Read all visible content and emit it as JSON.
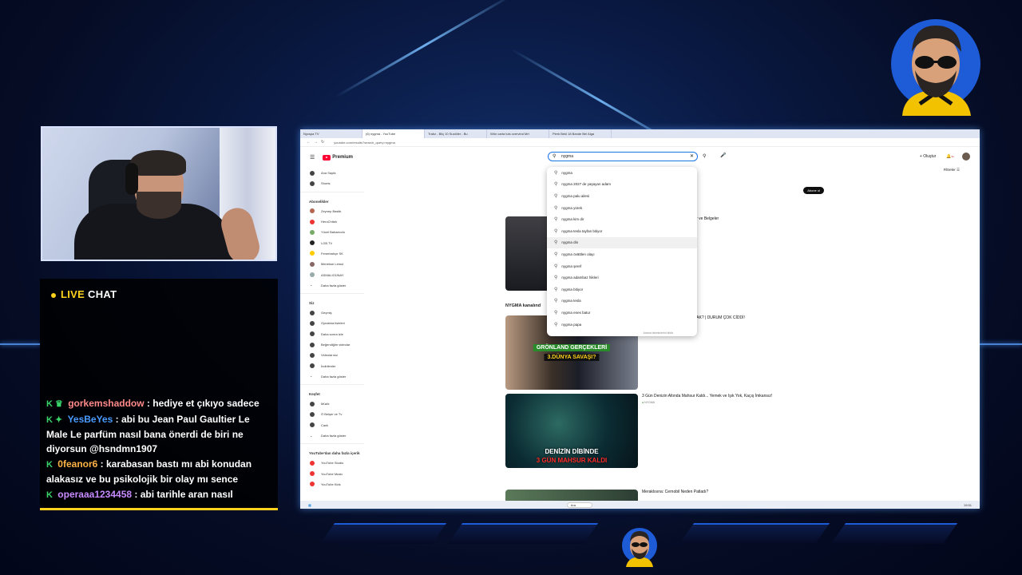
{
  "colors": {
    "accent": "#ffd21e",
    "glow": "#3a86ff",
    "yt_red": "#ff0033",
    "chat_badge": "#39d46a"
  },
  "chat": {
    "title_live": "LIVE",
    "title_chat": "CHAT",
    "messages": [
      {
        "user": "gorkemshaddow",
        "user_color": "#ff8a8a",
        "badge": "K ♛",
        "text": ": hediye et çıkıyo sadece"
      },
      {
        "user": "YesBeYes",
        "user_color": "#4a9bff",
        "badge": "K ✦",
        "text": ": abi bu Jean Paul Gaultier Le Male Le parfüm nasıl bana önerdi de biri ne diyorsun @hsndmn1907"
      },
      {
        "user": "0feanor6",
        "user_color": "#ffb347",
        "badge": "K",
        "text": ": karabasan bastı mı abi konudan alakasız ve bu psikolojik bir olay mı sence"
      },
      {
        "user": "operaaa1234458",
        "user_color": "#c58bff",
        "badge": "K",
        "text": ": abi tarihle aran nasıl"
      }
    ]
  },
  "browser": {
    "tabs": [
      "Nycspa TV",
      "(6) nygma - YouTube",
      "Trabz - Bilç 10 Suclöler - Bu",
      "Wön carta tuis overvind Mrt",
      "Pierk Bekl 18 Bande Bel Alga"
    ],
    "url": "youtube.com/results?search_query=nygma",
    "search_query": "nygma",
    "premium_label": "Premium",
    "create_label": "Oluştur",
    "notif_count": "9+",
    "filters_label": "Filtreler",
    "subscribe_label": "Abone ol",
    "suggestions": [
      "nygma",
      "nygma 2027 de yaşayan adam",
      "nygma palu ailesi",
      "nygma yürek",
      "nygma kim dir",
      "nygma tesla tayfan bitiyor",
      "nygma din",
      "nygma övättlen olayı",
      "nygma şeref",
      "nygma adambaz hikleri",
      "nygma bitiyor",
      "nygma tesla",
      "nygma enes batur",
      "nygma papa"
    ],
    "suggestion_footer": "Arama tahminlerini bildir",
    "sidebar": {
      "top": [
        "Ana Sayfa",
        "Shorts"
      ],
      "subs_header": "Abonelikler",
      "subs": [
        "Zeynep Bastik",
        "HeroChitek",
        "Yücel Bahaecolu",
        "LGB TV",
        "Fenerbahçe SK",
        "Menekse Lemul",
        "ASMALIGÜNAY",
        "Daha fazla göster"
      ],
      "you_header": "Siz",
      "you": [
        "Geçmiş",
        "Oynatma listeleri",
        "Daha sonra izle",
        "Beğendiğim videolar",
        "Videolarınız",
        "İndirilenler",
        "Daha fazla göster"
      ],
      "explore_header": "Keşfet",
      "explore": [
        "Müzik",
        "Ö Belşer ve Tv",
        "Canlı",
        "Daha fazla göster"
      ],
      "more_header": "YouTube'dan daha fazla içerik",
      "more": [
        "YouTube Studio",
        "YouTube Music",
        "YouTube Kids"
      ]
    },
    "results": {
      "section_title": "NYGMA kanalınd",
      "video1_title": "ü Ölümü: Fotoğraflar, Günlükler ve Belgeler",
      "video2_title": "AND KRİZİYLE Mİ BAŞLAYACAK? | DURUM ÇOK CİDDİ!",
      "video2_label_1": "GRÖNLAND GERÇEKLERİ",
      "video2_label_2": "3.DÜNYA SAVAŞI?",
      "video3_title": "3 Gün Denizin Altında Mahsur Kaldı... Yemek ve Işık Yok, Kaçış İmkansız!",
      "video3_label_1": "DENİZİN DİBİNDE",
      "video3_label_2": "3 GÜN MAHSUR KALDI",
      "video3_channel": "NYGMA",
      "video4_title": "Meraklısına: Cernobil Neden Patladı?"
    },
    "taskbar_search": "Ara",
    "clock": "19:51"
  }
}
